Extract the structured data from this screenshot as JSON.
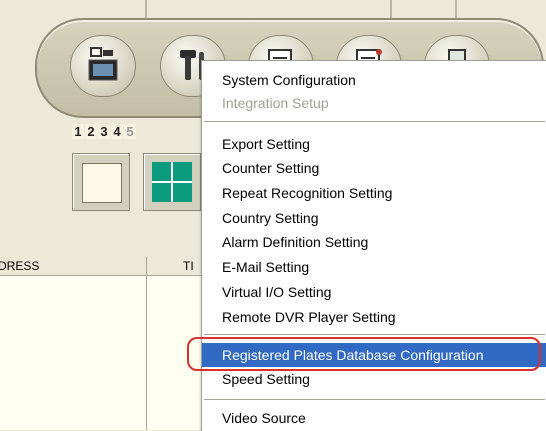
{
  "toolbar": {
    "buttons": [
      {
        "name": "camera-settings-button",
        "icon": "camera-monitor-icon"
      },
      {
        "name": "setup-tools-button",
        "icon": "tools-icon"
      },
      {
        "name": "report-button",
        "icon": "document-edit-icon"
      },
      {
        "name": "log-button",
        "icon": "document-alert-icon"
      },
      {
        "name": "network-button",
        "icon": "computer-icon"
      }
    ]
  },
  "pages": {
    "numbers": [
      "1",
      "2",
      "3",
      "4",
      "5"
    ]
  },
  "table": {
    "columns": {
      "address": "DRESS",
      "time": "TI"
    }
  },
  "menu": {
    "items": {
      "system_configuration": "System Configuration",
      "integration_setup": "Integration Setup",
      "export_setting": "Export Setting",
      "counter_setting": "Counter Setting",
      "repeat_recognition": "Repeat Recognition Setting",
      "country_setting": "Country Setting",
      "alarm_definition": "Alarm Definition Setting",
      "email_setting": "E-Mail Setting",
      "virtual_io": "Virtual I/O Setting",
      "remote_dvr": "Remote DVR Player Setting",
      "registered_plates": "Registered Plates Database Configuration",
      "speed_setting": "Speed Setting",
      "video_source": "Video Source"
    },
    "selected": "registered_plates"
  },
  "colors": {
    "selection": "#316ac5",
    "annotation_ring": "#d93030",
    "layout_quad": "#0c9b7c"
  }
}
